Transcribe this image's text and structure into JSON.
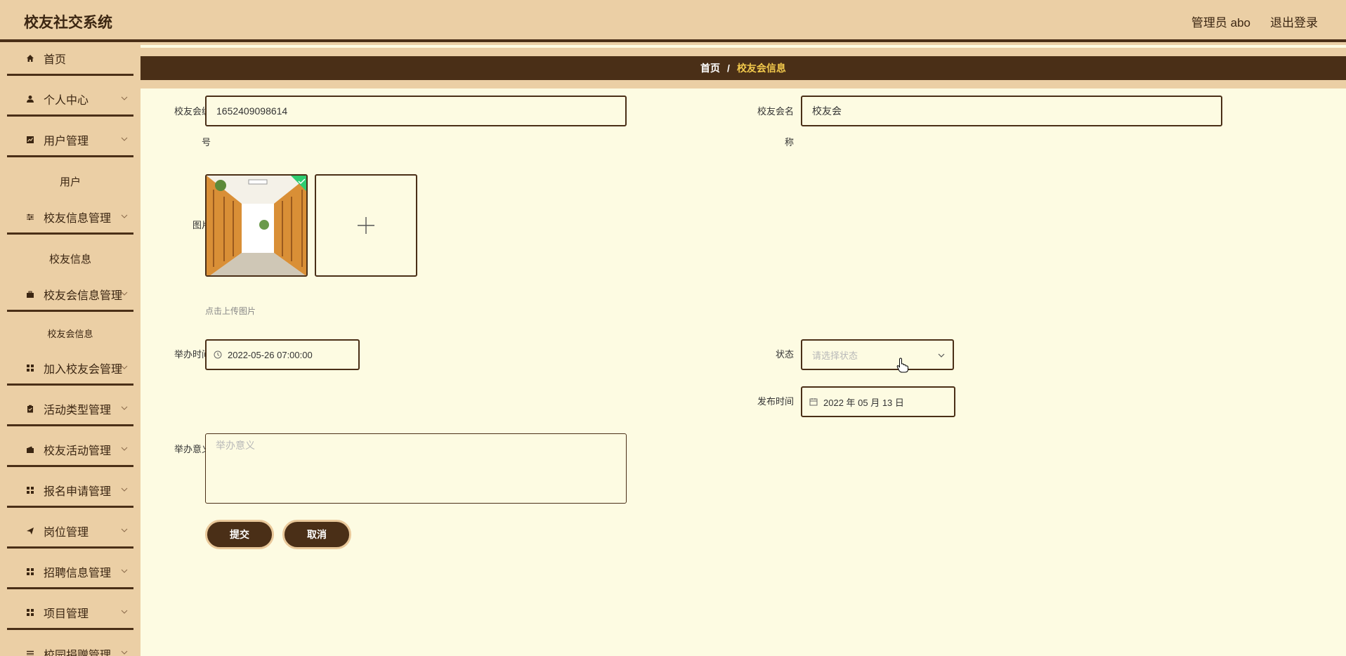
{
  "app": {
    "title": "校友社交系统",
    "user_label": "管理员 abo",
    "logout_label": "退出登录"
  },
  "sidebar": {
    "items": [
      {
        "label": "首页",
        "icon": "home-icon",
        "has_arrow": false
      },
      {
        "label": "个人中心",
        "icon": "person-icon",
        "has_arrow": true
      },
      {
        "label": "用户管理",
        "icon": "chart-icon",
        "has_arrow": true
      },
      {
        "label": "用户",
        "sub": true
      },
      {
        "label": "校友信息管理",
        "icon": "sliders-icon",
        "has_arrow": true
      },
      {
        "label": "校友信息",
        "sub": true
      },
      {
        "label": "校友会信息管理",
        "icon": "briefcase-icon",
        "has_arrow": true
      },
      {
        "label": "校友会信息",
        "sub": true
      },
      {
        "label": "加入校友会管理",
        "icon": "grid-icon",
        "has_arrow": true
      },
      {
        "label": "活动类型管理",
        "icon": "clipboard-icon",
        "has_arrow": true
      },
      {
        "label": "校友活动管理",
        "icon": "wallet-icon",
        "has_arrow": true
      },
      {
        "label": "报名申请管理",
        "icon": "grid-icon",
        "has_arrow": true
      },
      {
        "label": "岗位管理",
        "icon": "send-icon",
        "has_arrow": true
      },
      {
        "label": "招聘信息管理",
        "icon": "grid-icon",
        "has_arrow": true
      },
      {
        "label": "项目管理",
        "icon": "grid-icon",
        "has_arrow": true
      },
      {
        "label": "校园捐赠管理",
        "icon": "list-icon",
        "has_arrow": true
      }
    ]
  },
  "breadcrumb": {
    "home": "首页",
    "separator": "/",
    "current": "校友会信息"
  },
  "form": {
    "id_label_line1": "校友会编",
    "id_label_line2": "号",
    "id_value": "1652409098614",
    "name_label_line1": "校友会名",
    "name_label_line2": "称",
    "name_value": "校友会",
    "image_label": "图片",
    "upload_hint": "点击上传图片",
    "time_label": "举办时间",
    "time_value": "2022-05-26 07:00:00",
    "status_label": "状态",
    "status_placeholder": "请选择状态",
    "publish_label": "发布时间",
    "publish_value": "2022 年 05 月 13 日",
    "meaning_label": "举办意义",
    "meaning_placeholder": "举办意义",
    "submit_label": "提交",
    "cancel_label": "取消"
  },
  "colors": {
    "brand_dark": "#4a2f17",
    "sidebar_bg": "#ebcfa5",
    "content_bg": "#fdfbe2",
    "breadcrumb_active": "#f2c94c",
    "upload_success": "#2ecc71"
  }
}
